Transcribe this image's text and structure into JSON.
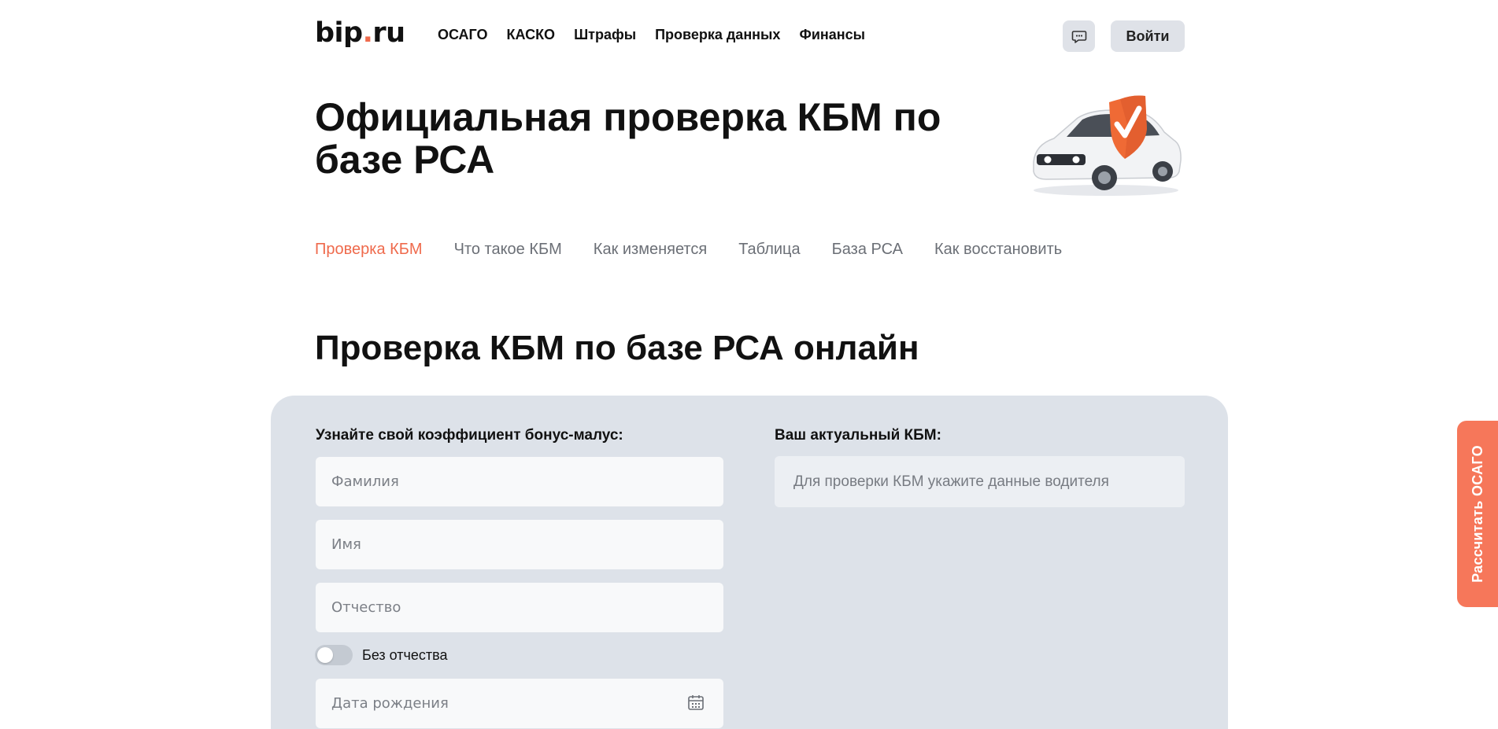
{
  "header": {
    "logo_text": "bip",
    "logo_dot": ".",
    "logo_suffix": "ru",
    "nav": [
      "ОСАГО",
      "КАСКО",
      "Штрафы",
      "Проверка данных",
      "Финансы"
    ],
    "chat_icon": "chat-icon",
    "login_label": "Войти"
  },
  "hero": {
    "title": "Официальная проверка КБМ по базе РСА",
    "art_icon": "car-with-shield-check-icon"
  },
  "tabs": {
    "items": [
      "Проверка КБМ",
      "Что такое КБМ",
      "Как изменяется",
      "Таблица",
      "База РСА",
      "Как восстановить"
    ],
    "active_index": 0
  },
  "section": {
    "title": "Проверка КБМ по базе РСА онлайн"
  },
  "form": {
    "left_label": "Узнайте свой коэффициент бонус-малус:",
    "last_name_placeholder": "Фамилия",
    "first_name_placeholder": "Имя",
    "middle_name_placeholder": "Отчество",
    "no_middle_name_label": "Без отчества",
    "no_middle_name_checked": false,
    "birth_date_placeholder": "Дата рождения",
    "calendar_icon": "calendar-icon"
  },
  "result": {
    "label": "Ваш актуальный КБМ:",
    "placeholder_text": "Для проверки КБМ укажите данные водителя"
  },
  "side_tab": {
    "label": "Рассчитать ОСАГО"
  },
  "colors": {
    "accent": "#ef6a4c",
    "side_tab": "#f6775a",
    "card_bg": "#dde2e9",
    "button_bg": "#dfe2e8"
  }
}
